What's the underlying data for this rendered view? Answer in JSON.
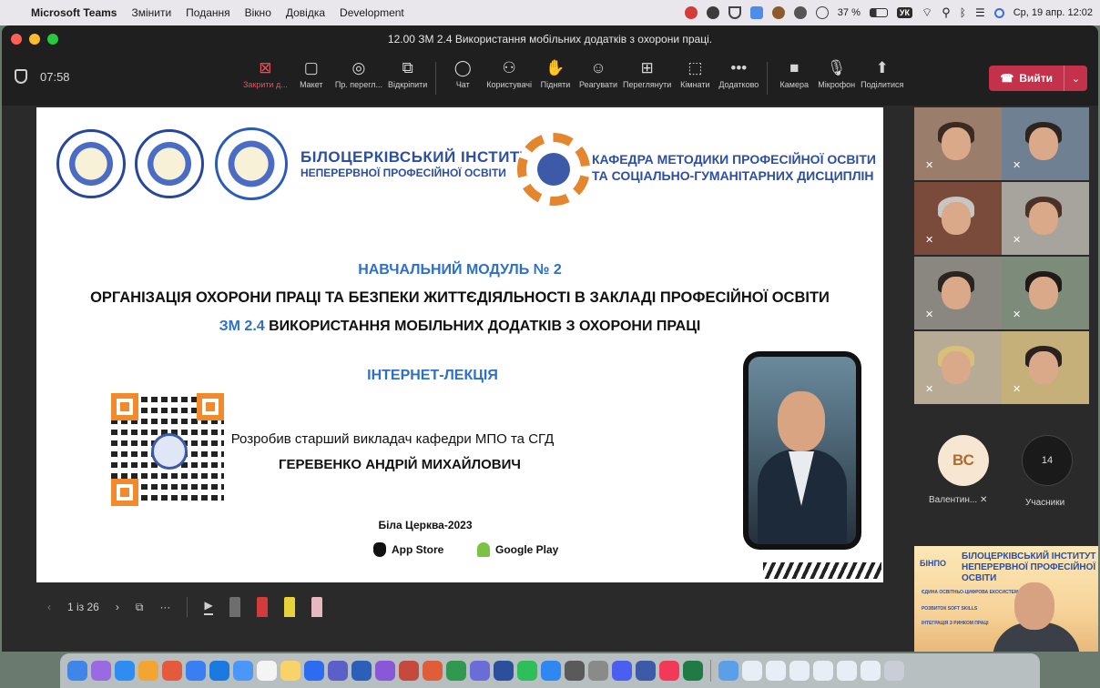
{
  "menubar": {
    "app": "Microsoft Teams",
    "items": [
      "Змінити",
      "Подання",
      "Вікно",
      "Довідка",
      "Development"
    ],
    "battery": "37 %",
    "keyboard": "УК",
    "datetime": "Ср, 19 апр.  12:02"
  },
  "window": {
    "title": "12.00 ЗМ 2.4 Використання мобільних додатків з охорони праці."
  },
  "toolbar": {
    "timer": "07:58",
    "tools": [
      {
        "label": "Закрити д...",
        "icon": "close-square-icon",
        "glyph": "⊠"
      },
      {
        "label": "Макет",
        "icon": "layout-icon",
        "glyph": "▢"
      },
      {
        "label": "Пр. перегл...",
        "icon": "eye-icon",
        "glyph": "◎"
      },
      {
        "label": "Відкріпити",
        "icon": "popout-icon",
        "glyph": "⧉"
      },
      {
        "label": "Чат",
        "icon": "chat-icon",
        "glyph": "◯"
      },
      {
        "label": "Користувачі",
        "icon": "people-icon",
        "glyph": "⚇"
      },
      {
        "label": "Підняти",
        "icon": "raise-hand-icon",
        "glyph": "✋"
      },
      {
        "label": "Реагувати",
        "icon": "smiley-icon",
        "glyph": "☺"
      },
      {
        "label": "Переглянути",
        "icon": "grid-view-icon",
        "glyph": "⊞"
      },
      {
        "label": "Кімнати",
        "icon": "rooms-icon",
        "glyph": "⬚"
      },
      {
        "label": "Додатково",
        "icon": "more-icon",
        "glyph": "•••"
      },
      {
        "label": "Камера",
        "icon": "camera-icon",
        "glyph": "■"
      },
      {
        "label": "Мікрофон",
        "icon": "microphone-icon",
        "glyph": "🎙"
      },
      {
        "label": "Поділитися",
        "icon": "share-icon",
        "glyph": "⬆"
      }
    ],
    "leave": "Вийти"
  },
  "slide": {
    "institute_line1": "БІЛОЦЕРКІВСЬКИЙ ІНСТИТУТ",
    "institute_line2": "НЕПЕРЕРВНОЇ ПРОФЕСІЙНОЇ ОСВІТИ",
    "department_line1": "КАФЕДРА МЕТОДИКИ ПРОФЕСІЙНОЇ ОСВІТИ",
    "department_line2": "ТА СОЦІАЛЬНО-ГУМАНІТАРНИХ ДИСЦИПЛІН",
    "module": "НАВЧАЛЬНИЙ МОДУЛЬ № 2",
    "topic": "ОРГАНІЗАЦІЯ ОХОРОНИ ПРАЦІ ТА БЕЗПЕКИ ЖИТТЄДІЯЛЬНОСТІ В ЗАКЛАДІ ПРОФЕСІЙНОЇ ОСВІТИ",
    "submodule_code": "ЗМ 2.4",
    "submodule_title": "ВИКОРИСТАННЯ МОБІЛЬНИХ ДОДАТКІВ З ОХОРОНИ ПРАЦІ",
    "lecture": "ІНТЕРНЕТ-ЛЕКЦІЯ",
    "author_intro": "Розробив старший викладач кафедри МПО та СГД",
    "author_name": "ГЕРЕВЕНКО АНДРІЙ МИХАЙЛОВИЧ",
    "city_year": "Біла Церква-2023",
    "store1": "App Store",
    "store2": "Google Play",
    "colors": {
      "blue": "#2f6fc8",
      "orange": "#f08a2a",
      "navy": "#2c4fa3"
    }
  },
  "pager": {
    "page": "1 із 26"
  },
  "participants": {
    "avatar_initials": "ВС",
    "avatar_name": "Валентин...",
    "count": "14",
    "count_label": "Учасники"
  },
  "self_view": {
    "binpo": "БІНПО",
    "title_line1": "БІЛОЦЕРКІВСЬКИЙ ІНСТИТУТ",
    "title_line2": "НЕПЕРЕРВНОЇ ПРОФЕСІЙНОЇ ОСВІТИ",
    "tags": [
      "ЄДИНА ОСВІТНЬО-ЦИФРОВА ЕКОСИСТЕМА",
      "РОЗВИТОК SOFT SKILLS",
      "ІНТЕГРАЦІЯ З РИНКОМ ПРАЦІ"
    ]
  }
}
